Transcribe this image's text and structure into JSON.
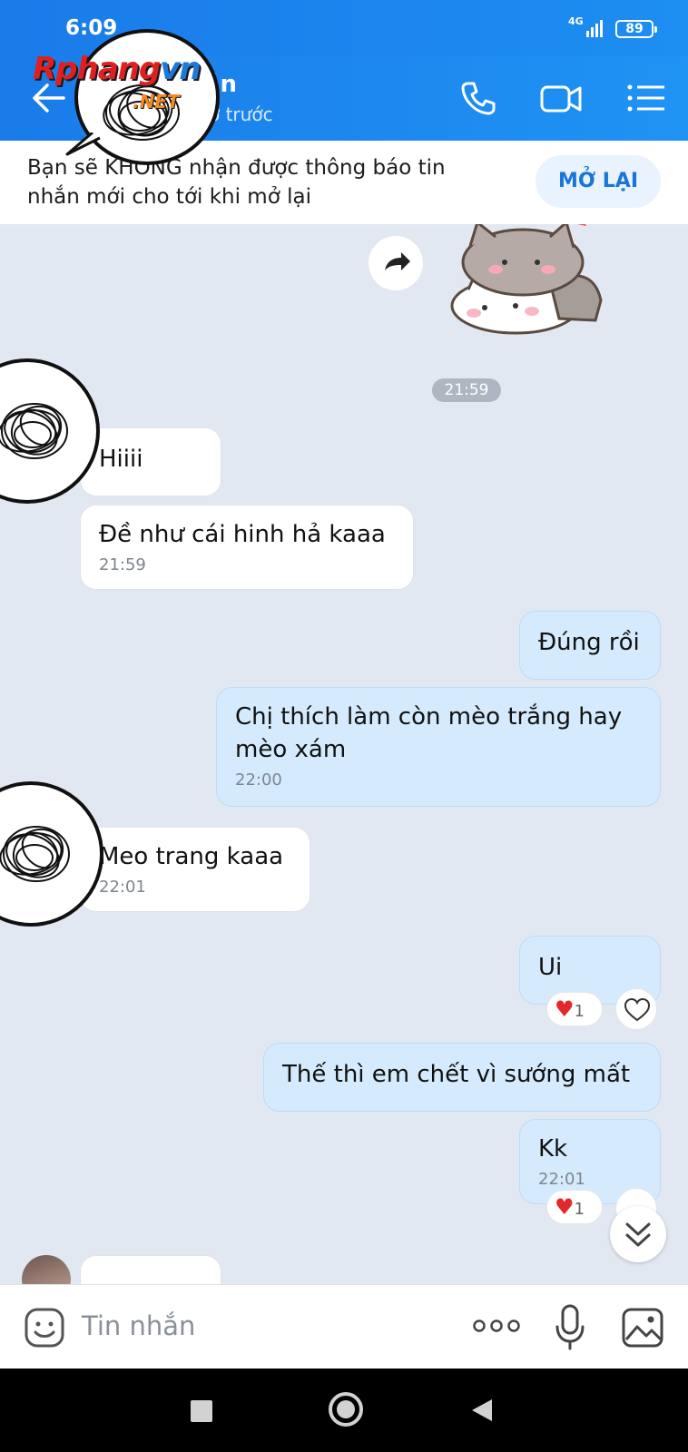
{
  "status_bar": {
    "time": "6:09",
    "network": "4G",
    "battery": "89"
  },
  "header": {
    "name_partial": "ản",
    "subtitle_partial": "ờ trước"
  },
  "watermark": {
    "brand": "Rphang",
    "brand_suffix": "vn",
    "net": ".NET"
  },
  "notice": {
    "text": "Bạn sẽ KHÔNG nhận được thông báo tin nhắn mới cho tới khi mở lại",
    "button": "MỞ LẠI"
  },
  "time_divider": "21:59",
  "messages": [
    {
      "side": "in",
      "text": "Hiiii"
    },
    {
      "side": "in",
      "text": "Đề như cái hinh hả kaaa",
      "time": "21:59"
    },
    {
      "side": "out",
      "text": "Đúng rồi"
    },
    {
      "side": "out",
      "text": "Chị thích làm còn mèo trắng hay mèo xám",
      "time": "22:00"
    },
    {
      "side": "in",
      "text": "Meo trang kaaa",
      "time": "22:01"
    },
    {
      "side": "out",
      "text": "Ui",
      "reaction_count": "1"
    },
    {
      "side": "out",
      "text": "Thế thì em chết vì sướng mất"
    },
    {
      "side": "out",
      "text": "Kk",
      "time": "22:01",
      "reaction_count": "1"
    }
  ],
  "input": {
    "placeholder": "Tin nhắn"
  },
  "icons": {
    "back": "arrow-left-icon",
    "call": "phone-icon",
    "video": "video-camera-icon",
    "menu": "list-menu-icon",
    "forward": "forward-icon",
    "emoji": "emoji-icon",
    "more": "more-dots-icon",
    "mic": "microphone-icon",
    "image": "image-icon",
    "scroll": "double-chevron-down-icon",
    "heart": "heart-icon"
  },
  "colors": {
    "header_blue": "#1a7be9",
    "outgoing_bubble": "#d5ebfd",
    "chat_bg": "#e2e8f1",
    "accent": "#1a74d9"
  }
}
